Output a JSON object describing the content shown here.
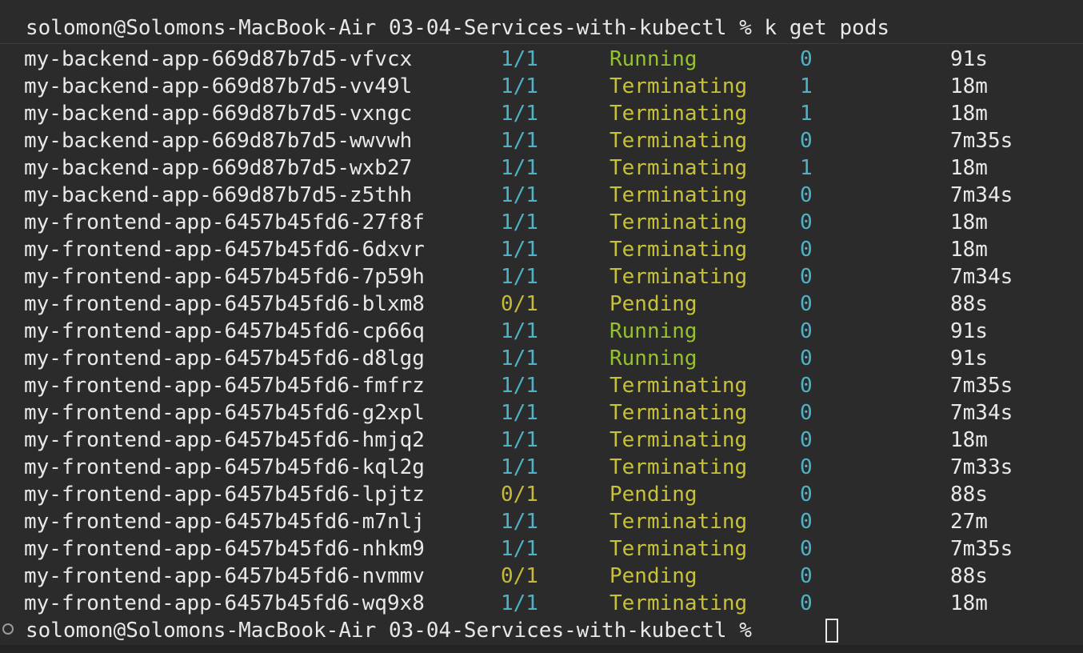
{
  "terminal": {
    "command_prompt": "solomon@Solomons-MacBook-Air 03-04-Services-with-kubectl % k get pods",
    "current_prompt": "solomon@Solomons-MacBook-Air 03-04-Services-with-kubectl % ",
    "colors": {
      "background": "#2b2b2b",
      "text": "#e8e8e8",
      "cyan": "#4fb3c8",
      "green": "#95c22f",
      "yellow": "#c7c23a"
    }
  },
  "pods": [
    {
      "name": "my-backend-app-669d87b7d5-vfvcx",
      "ready": "1/1",
      "status": "Running",
      "restarts": "0",
      "age": "91s"
    },
    {
      "name": "my-backend-app-669d87b7d5-vv49l",
      "ready": "1/1",
      "status": "Terminating",
      "restarts": "1",
      "age": "18m"
    },
    {
      "name": "my-backend-app-669d87b7d5-vxngc",
      "ready": "1/1",
      "status": "Terminating",
      "restarts": "1",
      "age": "18m"
    },
    {
      "name": "my-backend-app-669d87b7d5-wwvwh",
      "ready": "1/1",
      "status": "Terminating",
      "restarts": "0",
      "age": "7m35s"
    },
    {
      "name": "my-backend-app-669d87b7d5-wxb27",
      "ready": "1/1",
      "status": "Terminating",
      "restarts": "1",
      "age": "18m"
    },
    {
      "name": "my-backend-app-669d87b7d5-z5thh",
      "ready": "1/1",
      "status": "Terminating",
      "restarts": "0",
      "age": "7m34s"
    },
    {
      "name": "my-frontend-app-6457b45fd6-27f8f",
      "ready": "1/1",
      "status": "Terminating",
      "restarts": "0",
      "age": "18m"
    },
    {
      "name": "my-frontend-app-6457b45fd6-6dxvr",
      "ready": "1/1",
      "status": "Terminating",
      "restarts": "0",
      "age": "18m"
    },
    {
      "name": "my-frontend-app-6457b45fd6-7p59h",
      "ready": "1/1",
      "status": "Terminating",
      "restarts": "0",
      "age": "7m34s"
    },
    {
      "name": "my-frontend-app-6457b45fd6-blxm8",
      "ready": "0/1",
      "status": "Pending",
      "restarts": "0",
      "age": "88s"
    },
    {
      "name": "my-frontend-app-6457b45fd6-cp66q",
      "ready": "1/1",
      "status": "Running",
      "restarts": "0",
      "age": "91s"
    },
    {
      "name": "my-frontend-app-6457b45fd6-d8lgg",
      "ready": "1/1",
      "status": "Running",
      "restarts": "0",
      "age": "91s"
    },
    {
      "name": "my-frontend-app-6457b45fd6-fmfrz",
      "ready": "1/1",
      "status": "Terminating",
      "restarts": "0",
      "age": "7m35s"
    },
    {
      "name": "my-frontend-app-6457b45fd6-g2xpl",
      "ready": "1/1",
      "status": "Terminating",
      "restarts": "0",
      "age": "7m34s"
    },
    {
      "name": "my-frontend-app-6457b45fd6-hmjq2",
      "ready": "1/1",
      "status": "Terminating",
      "restarts": "0",
      "age": "18m"
    },
    {
      "name": "my-frontend-app-6457b45fd6-kql2g",
      "ready": "1/1",
      "status": "Terminating",
      "restarts": "0",
      "age": "7m33s"
    },
    {
      "name": "my-frontend-app-6457b45fd6-lpjtz",
      "ready": "0/1",
      "status": "Pending",
      "restarts": "0",
      "age": "88s"
    },
    {
      "name": "my-frontend-app-6457b45fd6-m7nlj",
      "ready": "1/1",
      "status": "Terminating",
      "restarts": "0",
      "age": "27m"
    },
    {
      "name": "my-frontend-app-6457b45fd6-nhkm9",
      "ready": "1/1",
      "status": "Terminating",
      "restarts": "0",
      "age": "7m35s"
    },
    {
      "name": "my-frontend-app-6457b45fd6-nvmmv",
      "ready": "0/1",
      "status": "Pending",
      "restarts": "0",
      "age": "88s"
    },
    {
      "name": "my-frontend-app-6457b45fd6-wq9x8",
      "ready": "1/1",
      "status": "Terminating",
      "restarts": "0",
      "age": "18m"
    }
  ]
}
